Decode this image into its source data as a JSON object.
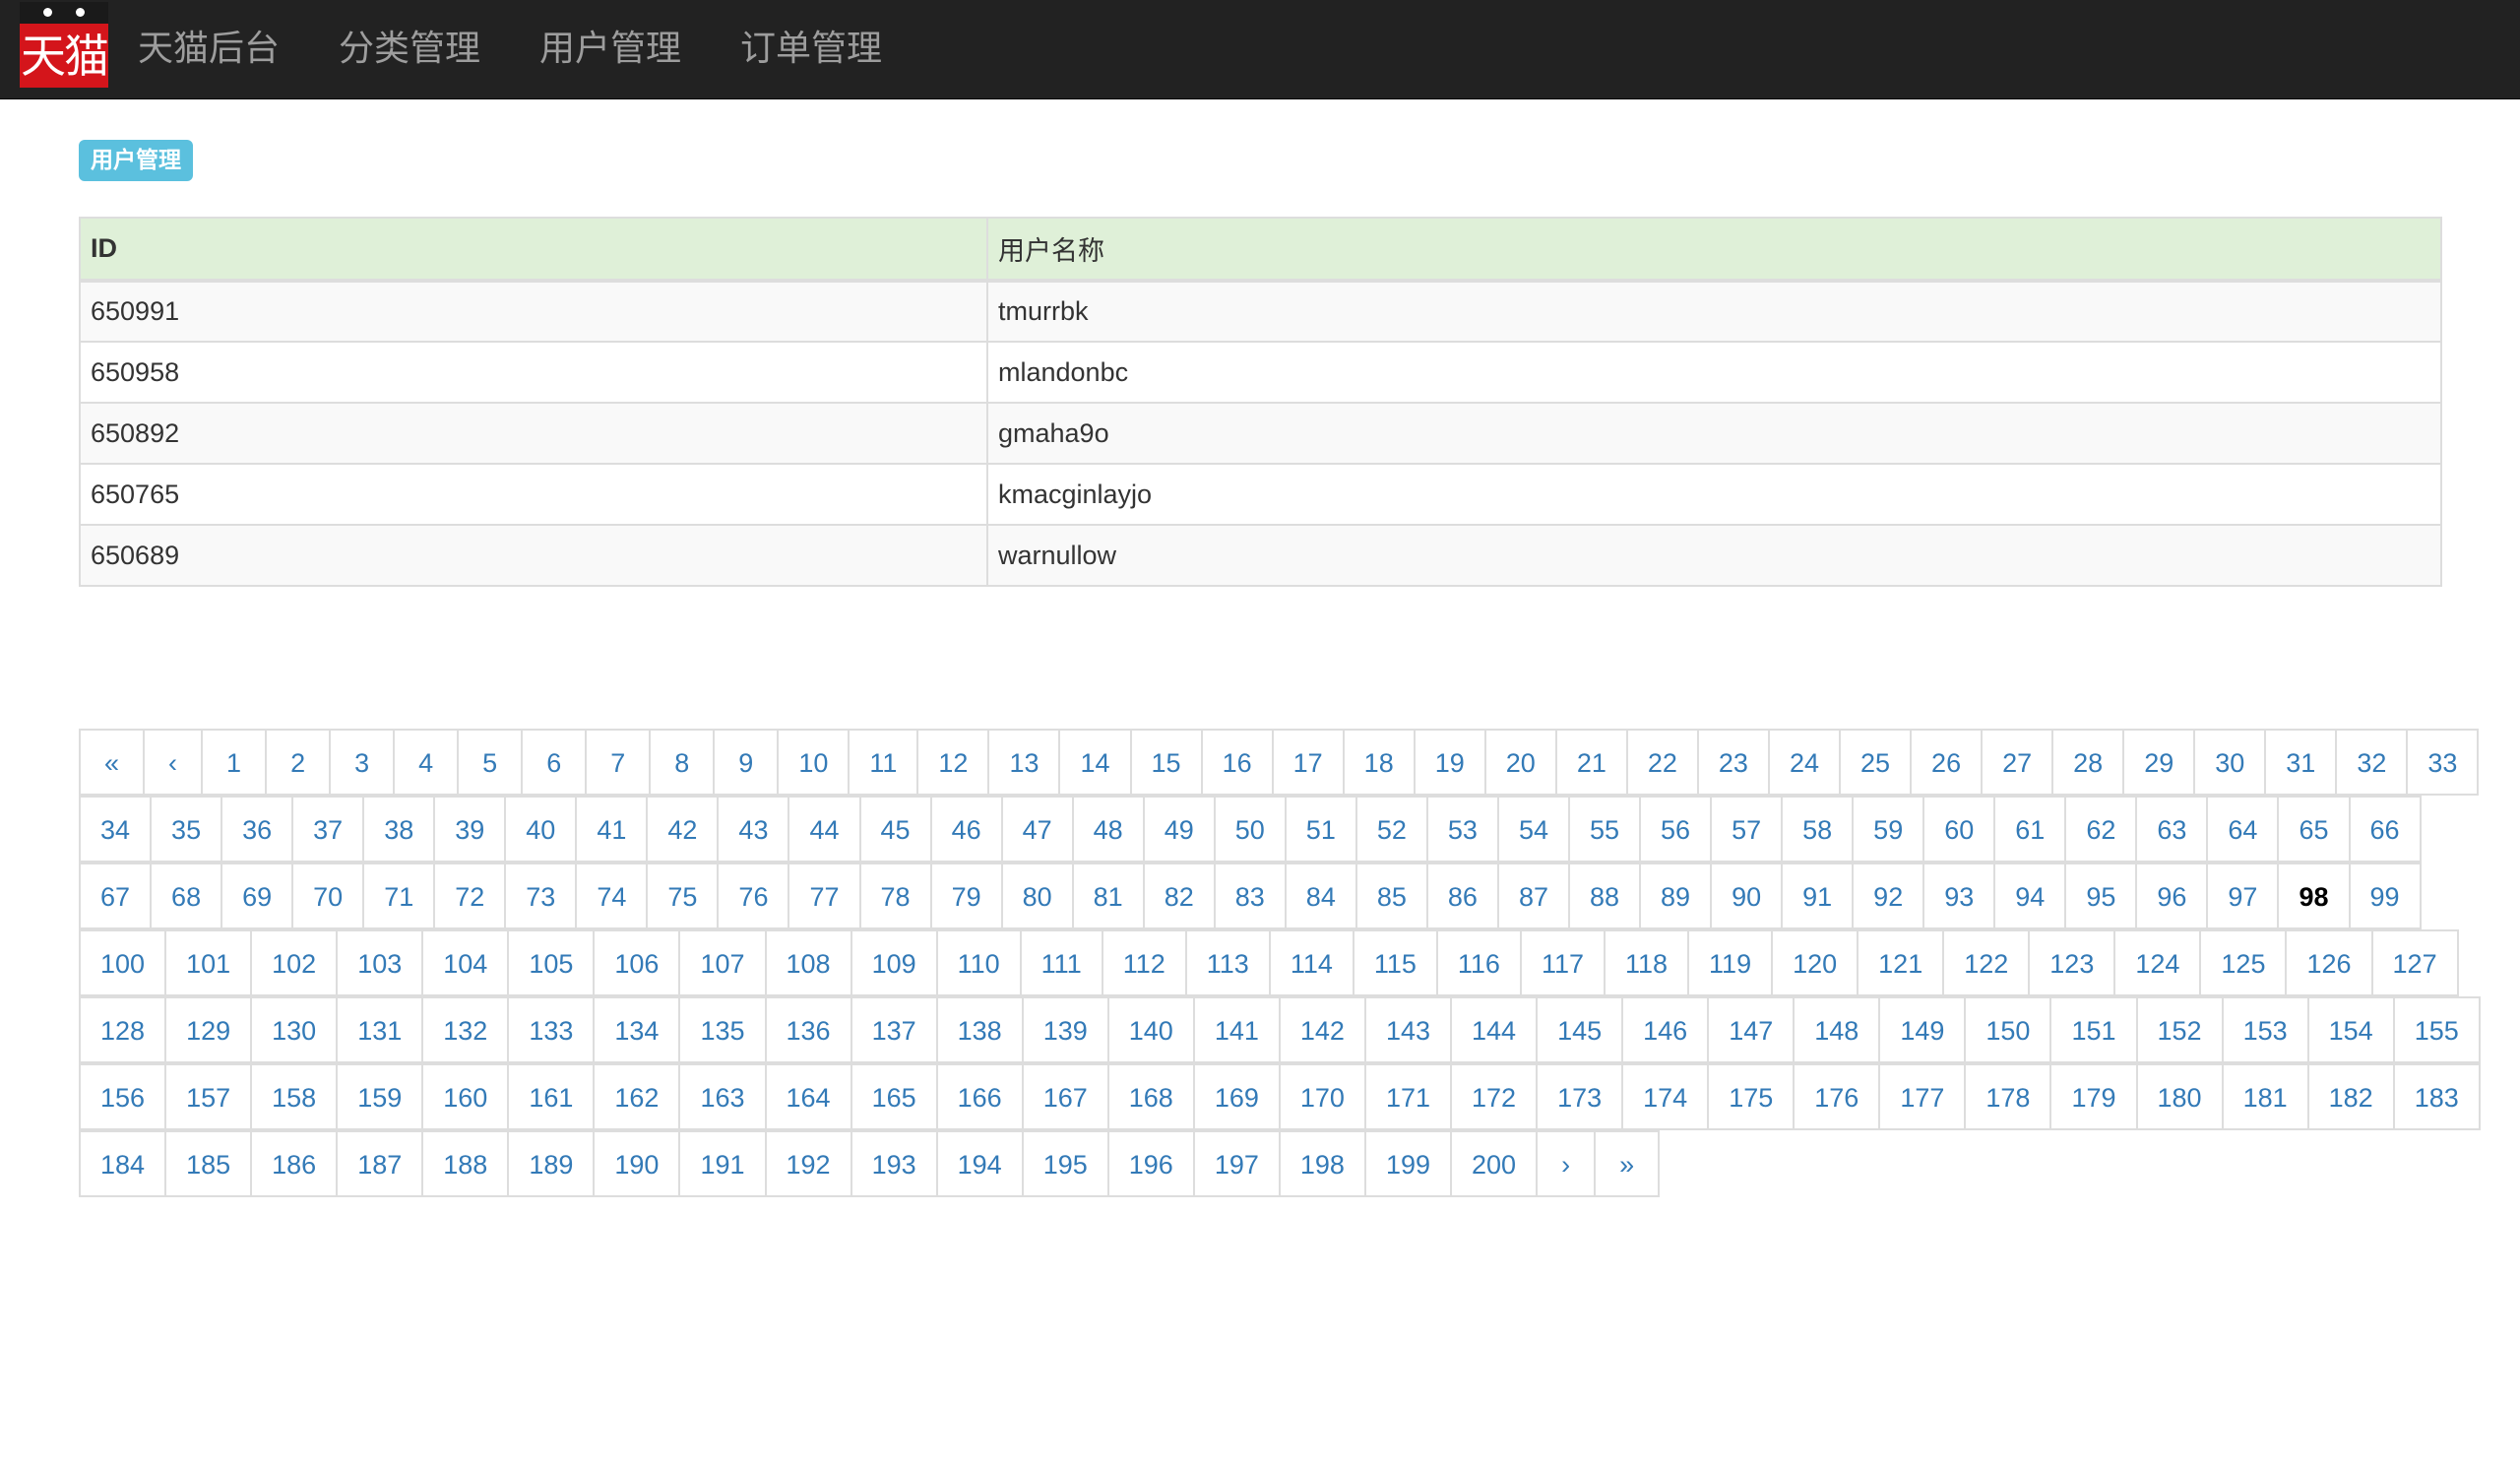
{
  "navbar": {
    "logo_text": "天猫",
    "items": [
      {
        "label": "天猫后台"
      },
      {
        "label": "分类管理"
      },
      {
        "label": "用户管理"
      },
      {
        "label": "订单管理"
      }
    ]
  },
  "page_label": "用户管理",
  "table": {
    "headers": [
      "ID",
      "用户名称"
    ],
    "rows": [
      [
        "650991",
        "tmurrbk"
      ],
      [
        "650958",
        "mlandonbc"
      ],
      [
        "650892",
        "gmaha9o"
      ],
      [
        "650765",
        "kmacginlayjo"
      ],
      [
        "650689",
        "warnullow"
      ]
    ]
  },
  "pagination": {
    "first_label": "«",
    "prev_label": "‹",
    "next_label": "›",
    "last_label": "»",
    "pages": [
      "1",
      "2",
      "3",
      "4",
      "5",
      "6",
      "7",
      "8",
      "9",
      "10",
      "11",
      "12",
      "13",
      "14",
      "15",
      "16",
      "17",
      "18",
      "19",
      "20",
      "21",
      "22",
      "23",
      "24",
      "25",
      "26",
      "27",
      "28",
      "29",
      "30",
      "31",
      "32",
      "33",
      "34",
      "35",
      "36",
      "37",
      "38",
      "39",
      "40",
      "41",
      "42",
      "43",
      "44",
      "45",
      "46",
      "47",
      "48",
      "49",
      "50",
      "51",
      "52",
      "53",
      "54",
      "55",
      "56",
      "57",
      "58",
      "59",
      "60",
      "61",
      "62",
      "63",
      "64",
      "65",
      "66",
      "67",
      "68",
      "69",
      "70",
      "71",
      "72",
      "73",
      "74",
      "75",
      "76",
      "77",
      "78",
      "79",
      "80",
      "81",
      "82",
      "83",
      "84",
      "85",
      "86",
      "87",
      "88",
      "89",
      "90",
      "91",
      "92",
      "93",
      "94",
      "95",
      "96",
      "97",
      "98",
      "99",
      "100",
      "101",
      "102",
      "103",
      "104",
      "105",
      "106",
      "107",
      "108",
      "109",
      "110",
      "111",
      "112",
      "113",
      "114",
      "115",
      "116",
      "117",
      "118",
      "119",
      "120",
      "121",
      "122",
      "123",
      "124",
      "125",
      "126",
      "127",
      "128",
      "129",
      "130",
      "131",
      "132",
      "133",
      "134",
      "135",
      "136",
      "137",
      "138",
      "139",
      "140",
      "141",
      "142",
      "143",
      "144",
      "145",
      "146",
      "147",
      "148",
      "149",
      "150",
      "151",
      "152",
      "153",
      "154",
      "155",
      "156",
      "157",
      "158",
      "159",
      "160",
      "161",
      "162",
      "163",
      "164",
      "165",
      "166",
      "167",
      "168",
      "169",
      "170",
      "171",
      "172",
      "173",
      "174",
      "175",
      "176",
      "177",
      "178",
      "179",
      "180",
      "181",
      "182",
      "183",
      "184",
      "185",
      "186",
      "187",
      "188",
      "189",
      "190",
      "191",
      "192",
      "193",
      "194",
      "195",
      "196",
      "197",
      "198",
      "199",
      "200"
    ],
    "current_page": "98"
  },
  "colors": {
    "navbar_bg": "#222222",
    "link": "#337ab7",
    "label_bg": "#5bc0de",
    "table_header_bg": "#dff0d8"
  }
}
